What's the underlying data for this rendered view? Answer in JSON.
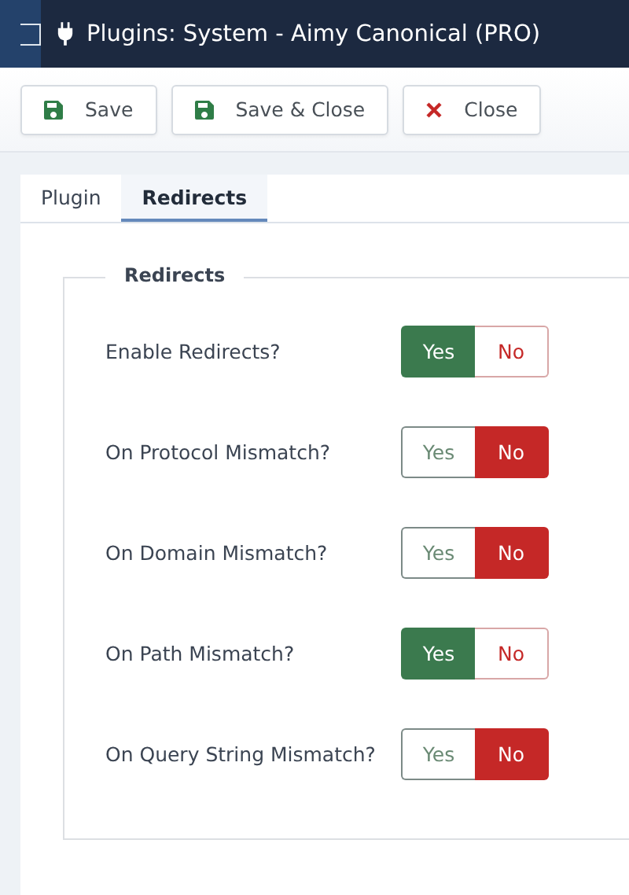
{
  "header": {
    "title": "Plugins: System - Aimy Canonical (PRO)"
  },
  "toolbar": [
    {
      "label": "Save",
      "kind": "save"
    },
    {
      "label": "Save & Close",
      "kind": "save"
    },
    {
      "label": "Close",
      "kind": "close"
    }
  ],
  "tabs": [
    {
      "label": "Plugin",
      "selected": false
    },
    {
      "label": "Redirects",
      "selected": true
    }
  ],
  "fieldset": {
    "legend": "Redirects",
    "fields": [
      {
        "label": "Enable Redirects?",
        "options": [
          {
            "label": "Yes",
            "kind": "yes",
            "selected": true
          },
          {
            "label": "No",
            "kind": "no",
            "selected": false
          }
        ]
      },
      {
        "label": "On Protocol Mismatch?",
        "options": [
          {
            "label": "Yes",
            "kind": "yes",
            "selected": false
          },
          {
            "label": "No",
            "kind": "no",
            "selected": true
          }
        ]
      },
      {
        "label": "On Domain Mismatch?",
        "options": [
          {
            "label": "Yes",
            "kind": "yes",
            "selected": false
          },
          {
            "label": "No",
            "kind": "no",
            "selected": true
          }
        ]
      },
      {
        "label": "On Path Mismatch?",
        "options": [
          {
            "label": "Yes",
            "kind": "yes",
            "selected": true
          },
          {
            "label": "No",
            "kind": "no",
            "selected": false
          }
        ]
      },
      {
        "label": "On Query String Mismatch?",
        "options": [
          {
            "label": "Yes",
            "kind": "yes",
            "selected": false
          },
          {
            "label": "No",
            "kind": "no",
            "selected": true
          }
        ]
      }
    ]
  }
}
